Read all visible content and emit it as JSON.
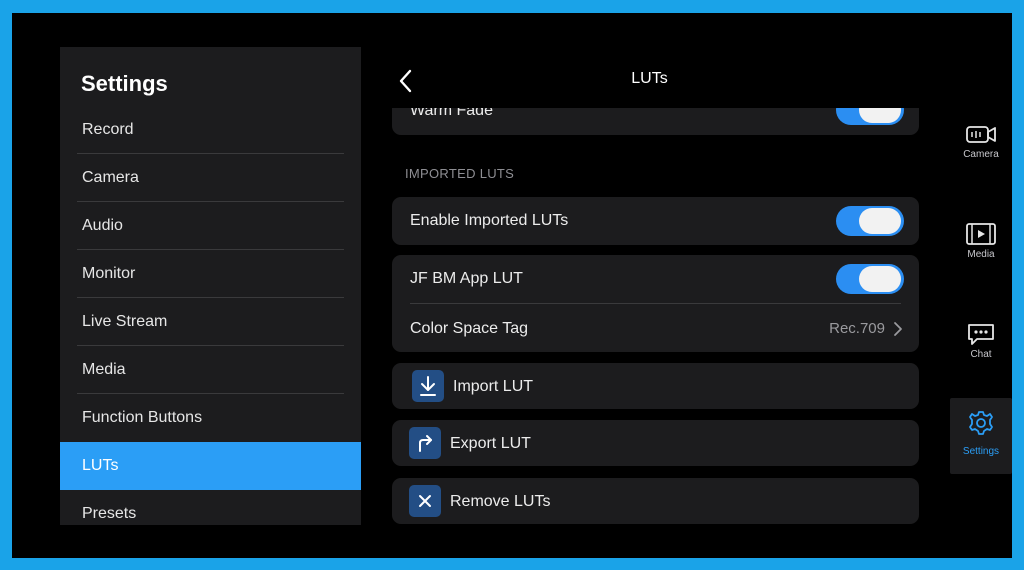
{
  "sidebar": {
    "title": "Settings",
    "items": [
      {
        "label": "Record"
      },
      {
        "label": "Camera"
      },
      {
        "label": "Audio"
      },
      {
        "label": "Monitor"
      },
      {
        "label": "Live Stream"
      },
      {
        "label": "Media"
      },
      {
        "label": "Function Buttons"
      },
      {
        "label": "LUTs",
        "active": true
      },
      {
        "label": "Presets"
      }
    ]
  },
  "header": {
    "title": "LUTs",
    "back_icon": "chevron-left-icon"
  },
  "main": {
    "warm_fade": {
      "label": "Warm Fade",
      "enabled": true
    },
    "section_imported": "IMPORTED LUTS",
    "enable_imported": {
      "label": "Enable Imported LUTs",
      "enabled": true
    },
    "lut_item": {
      "label": "JF BM App LUT",
      "enabled": true,
      "color_space_label": "Color Space Tag",
      "color_space_value": "Rec.709"
    },
    "actions": {
      "import_label": "Import LUT",
      "export_label": "Export LUT",
      "remove_label": "Remove LUTs"
    }
  },
  "rail": [
    {
      "label": "Camera",
      "icon": "camera-icon"
    },
    {
      "label": "Media",
      "icon": "film-icon"
    },
    {
      "label": "Chat",
      "icon": "chat-icon"
    },
    {
      "label": "Settings",
      "icon": "gear-icon",
      "active": true
    }
  ],
  "colors": {
    "accent": "#2b9ef6",
    "background": "#000000",
    "panel": "#1c1c1e",
    "frame": "#1aa3e8"
  }
}
